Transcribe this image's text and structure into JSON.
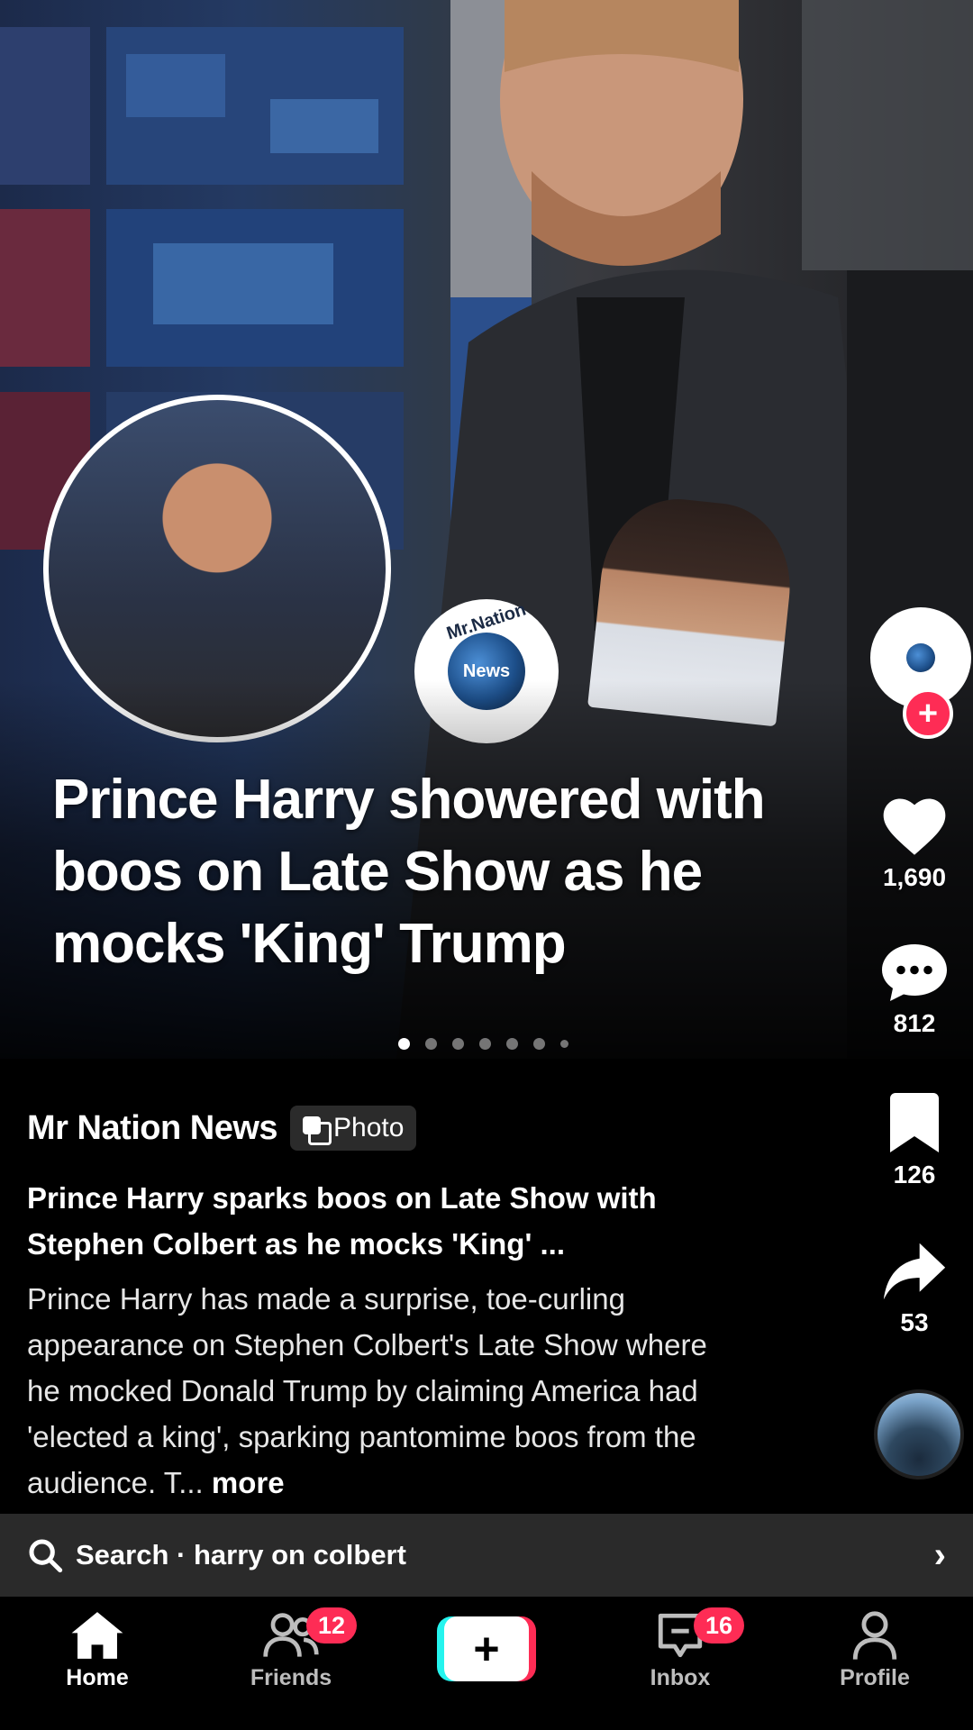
{
  "post": {
    "headline": "Prince Harry showered with boos on Late Show as he mocks 'King' Trump",
    "logo_ring_text": "Mr.Nation",
    "logo_center_text": "News",
    "carousel_pages": 7,
    "carousel_active_index": 0
  },
  "rail": {
    "follow_symbol": "+",
    "like_count": "1,690",
    "comment_count": "812",
    "save_count": "126",
    "share_count": "53",
    "icons": [
      "heart-icon",
      "comment-icon",
      "bookmark-icon",
      "share-icon"
    ]
  },
  "caption": {
    "author": "Mr Nation News",
    "type_badge": "Photo",
    "title": "Prince Harry sparks boos on Late Show with Stephen Colbert as he mocks 'King' ...",
    "description": "Prince Harry has made a surprise, toe-curling appearance on Stephen Colbert's Late Show where he mocked Donald Trump by claiming America had 'elected a king', sparking pantomime boos from the audience. T...",
    "more_label": "more"
  },
  "search": {
    "text": "Search · harry on colbert"
  },
  "nav": {
    "home": "Home",
    "friends": "Friends",
    "friends_badge": "12",
    "create_symbol": "+",
    "inbox": "Inbox",
    "inbox_badge": "16",
    "profile": "Profile"
  },
  "colors": {
    "accent": "#fe2c55",
    "accent_cyan": "#25f4ee",
    "search_bg": "#2a2a2a"
  }
}
